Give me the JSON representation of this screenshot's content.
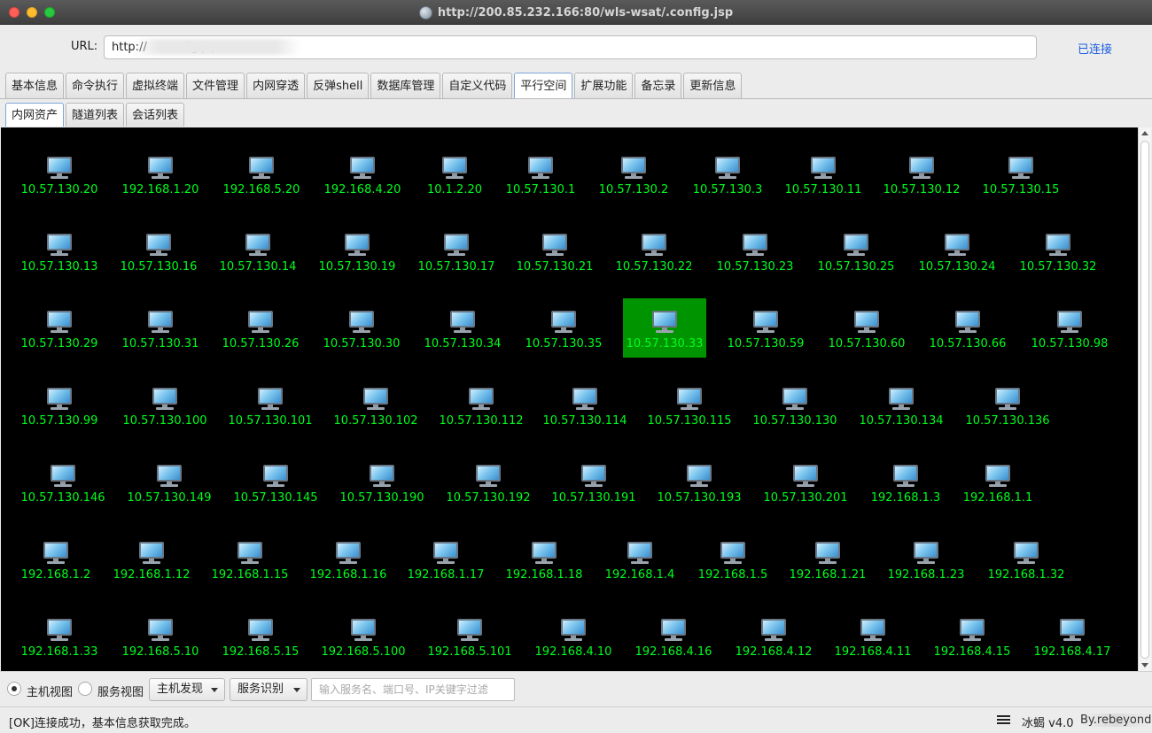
{
  "window": {
    "title": "http://200.85.232.166:80/wls-wsat/.config.jsp"
  },
  "url_bar": {
    "label": "URL:",
    "value": "http://          fig.jsp",
    "status": "已连接"
  },
  "tabs": [
    {
      "label": "基本信息",
      "active": false
    },
    {
      "label": "命令执行",
      "active": false
    },
    {
      "label": "虚拟终端",
      "active": false
    },
    {
      "label": "文件管理",
      "active": false
    },
    {
      "label": "内网穿透",
      "active": false
    },
    {
      "label": "反弹shell",
      "active": false
    },
    {
      "label": "数据库管理",
      "active": false
    },
    {
      "label": "自定义代码",
      "active": false
    },
    {
      "label": "平行空间",
      "active": true
    },
    {
      "label": "扩展功能",
      "active": false
    },
    {
      "label": "备忘录",
      "active": false
    },
    {
      "label": "更新信息",
      "active": false
    }
  ],
  "subtabs": [
    {
      "label": "内网资产",
      "active": true
    },
    {
      "label": "隧道列表",
      "active": false
    },
    {
      "label": "会话列表",
      "active": false
    }
  ],
  "hosts": {
    "row1": [
      "10.57.130.20",
      "192.168.1.20",
      "192.168.5.20",
      "192.168.4.20",
      "10.1.2.20",
      "10.57.130.1",
      "10.57.130.2",
      "10.57.130.3",
      "10.57.130.11",
      "10.57.130.12",
      "10.57.130.15"
    ],
    "row2": [
      "10.57.130.13",
      "10.57.130.16",
      "10.57.130.14",
      "10.57.130.19",
      "10.57.130.17",
      "10.57.130.21",
      "10.57.130.22",
      "10.57.130.23",
      "10.57.130.25",
      "10.57.130.24",
      "10.57.130.32"
    ],
    "row3": [
      "10.57.130.29",
      "10.57.130.31",
      "10.57.130.26",
      "10.57.130.30",
      "10.57.130.34",
      "10.57.130.35",
      "10.57.130.33",
      "10.57.130.59",
      "10.57.130.60",
      "10.57.130.66",
      "10.57.130.98"
    ],
    "row4": [
      "10.57.130.99",
      "10.57.130.100",
      "10.57.130.101",
      "10.57.130.102",
      "10.57.130.112",
      "10.57.130.114",
      "10.57.130.115",
      "10.57.130.130",
      "10.57.130.134",
      "10.57.130.136"
    ],
    "row5": [
      "10.57.130.146",
      "10.57.130.149",
      "10.57.130.145",
      "10.57.130.190",
      "10.57.130.192",
      "10.57.130.191",
      "10.57.130.193",
      "10.57.130.201",
      "192.168.1.3",
      "192.168.1.1"
    ],
    "row6": [
      "192.168.1.2",
      "192.168.1.12",
      "192.168.1.15",
      "192.168.1.16",
      "192.168.1.17",
      "192.168.1.18",
      "192.168.1.4",
      "192.168.1.5",
      "192.168.1.21",
      "192.168.1.23",
      "192.168.1.32"
    ],
    "row7": [
      "192.168.1.33",
      "192.168.5.10",
      "192.168.5.15",
      "192.168.5.100",
      "192.168.5.101",
      "192.168.4.10",
      "192.168.4.16",
      "192.168.4.12",
      "192.168.4.11",
      "192.168.4.15",
      "192.168.4.17"
    ],
    "selected": "10.57.130.33"
  },
  "colors": {
    "canvas_bg": "#000000",
    "host_label": "#00ff1e",
    "selected_bg": "#009400",
    "link_blue": "#1a5fe0"
  },
  "bottom": {
    "radio_host_view": "主机视图",
    "radio_service_view": "服务视图",
    "host_view_selected": true,
    "dropdown_discover": "主机发现",
    "dropdown_service": "服务识别",
    "filter_placeholder": "输入服务名、端口号、IP关键字过滤"
  },
  "status": {
    "message": "[OK]连接成功，基本信息获取完成。",
    "version": "冰蝎 v4.0",
    "author": "By.rebeyond"
  },
  "icons": {
    "host": "monitor-icon",
    "menu": "menu-icon"
  }
}
